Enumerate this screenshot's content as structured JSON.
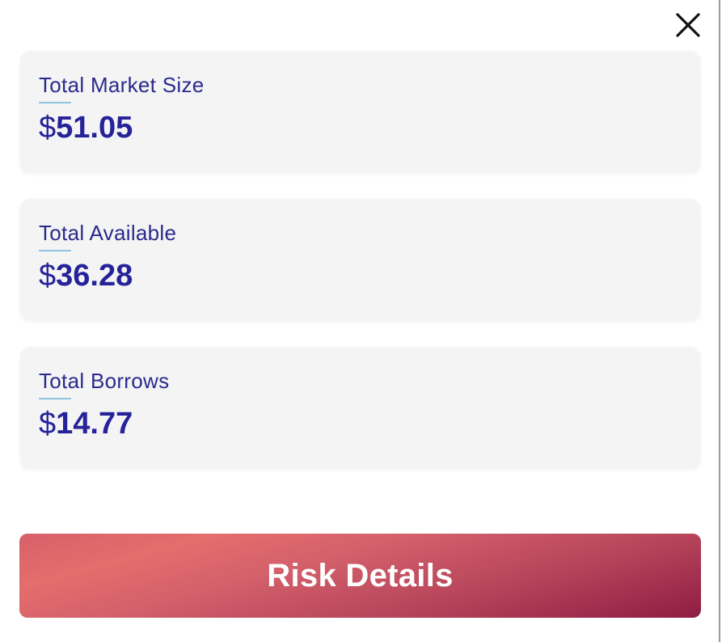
{
  "modal": {
    "close_icon": "close-icon"
  },
  "stats": [
    {
      "label": "Total Market Size",
      "currency": "$",
      "amount": "51.05"
    },
    {
      "label": "Total Available",
      "currency": "$",
      "amount": "36.28"
    },
    {
      "label": "Total Borrows",
      "currency": "$",
      "amount": "14.77"
    }
  ],
  "actions": {
    "risk_details_label": "Risk Details"
  },
  "colors": {
    "text_primary": "#2b2a8c",
    "underline_accent": "#8fc3dd",
    "card_background": "#f4f4f5",
    "button_gradient_start": "#8e1d43",
    "button_gradient_end": "#e46e6c"
  }
}
